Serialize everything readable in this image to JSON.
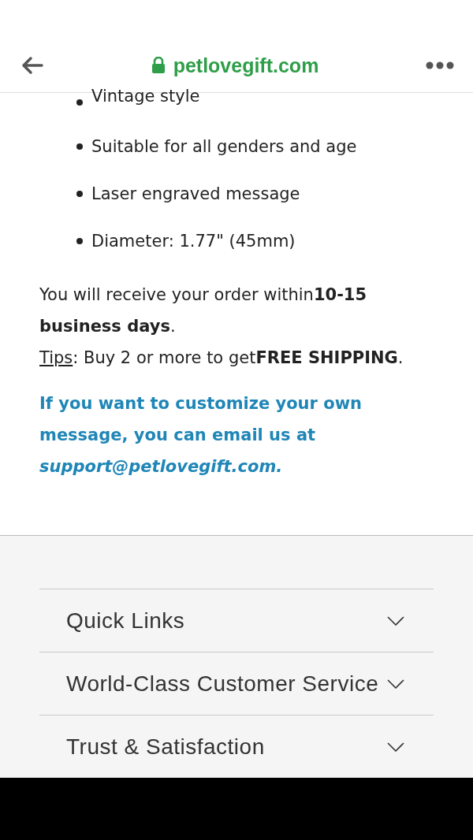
{
  "address_bar": {
    "url": "petlovegift.com",
    "secure": true
  },
  "features": [
    "Vintage style",
    "Suitable for all genders and age",
    "Laser engraved message",
    "Diameter: 1.77\" (45mm)"
  ],
  "delivery": "You will receive your order within**10-15 business days**.",
  "tips": {
    "label": "Tips",
    "text": ": Buy 2 or more to get**FREE SHIPPING**."
  },
  "customize": "If you want to customize your own message, you can email us at *support@petlovegift.com.*",
  "footer_sections": [
    {
      "title": "Quick Links",
      "expanded": false
    },
    {
      "title": "World-Class Customer Service",
      "expanded": false
    },
    {
      "title": "Trust & Satisfaction",
      "expanded": false
    }
  ]
}
